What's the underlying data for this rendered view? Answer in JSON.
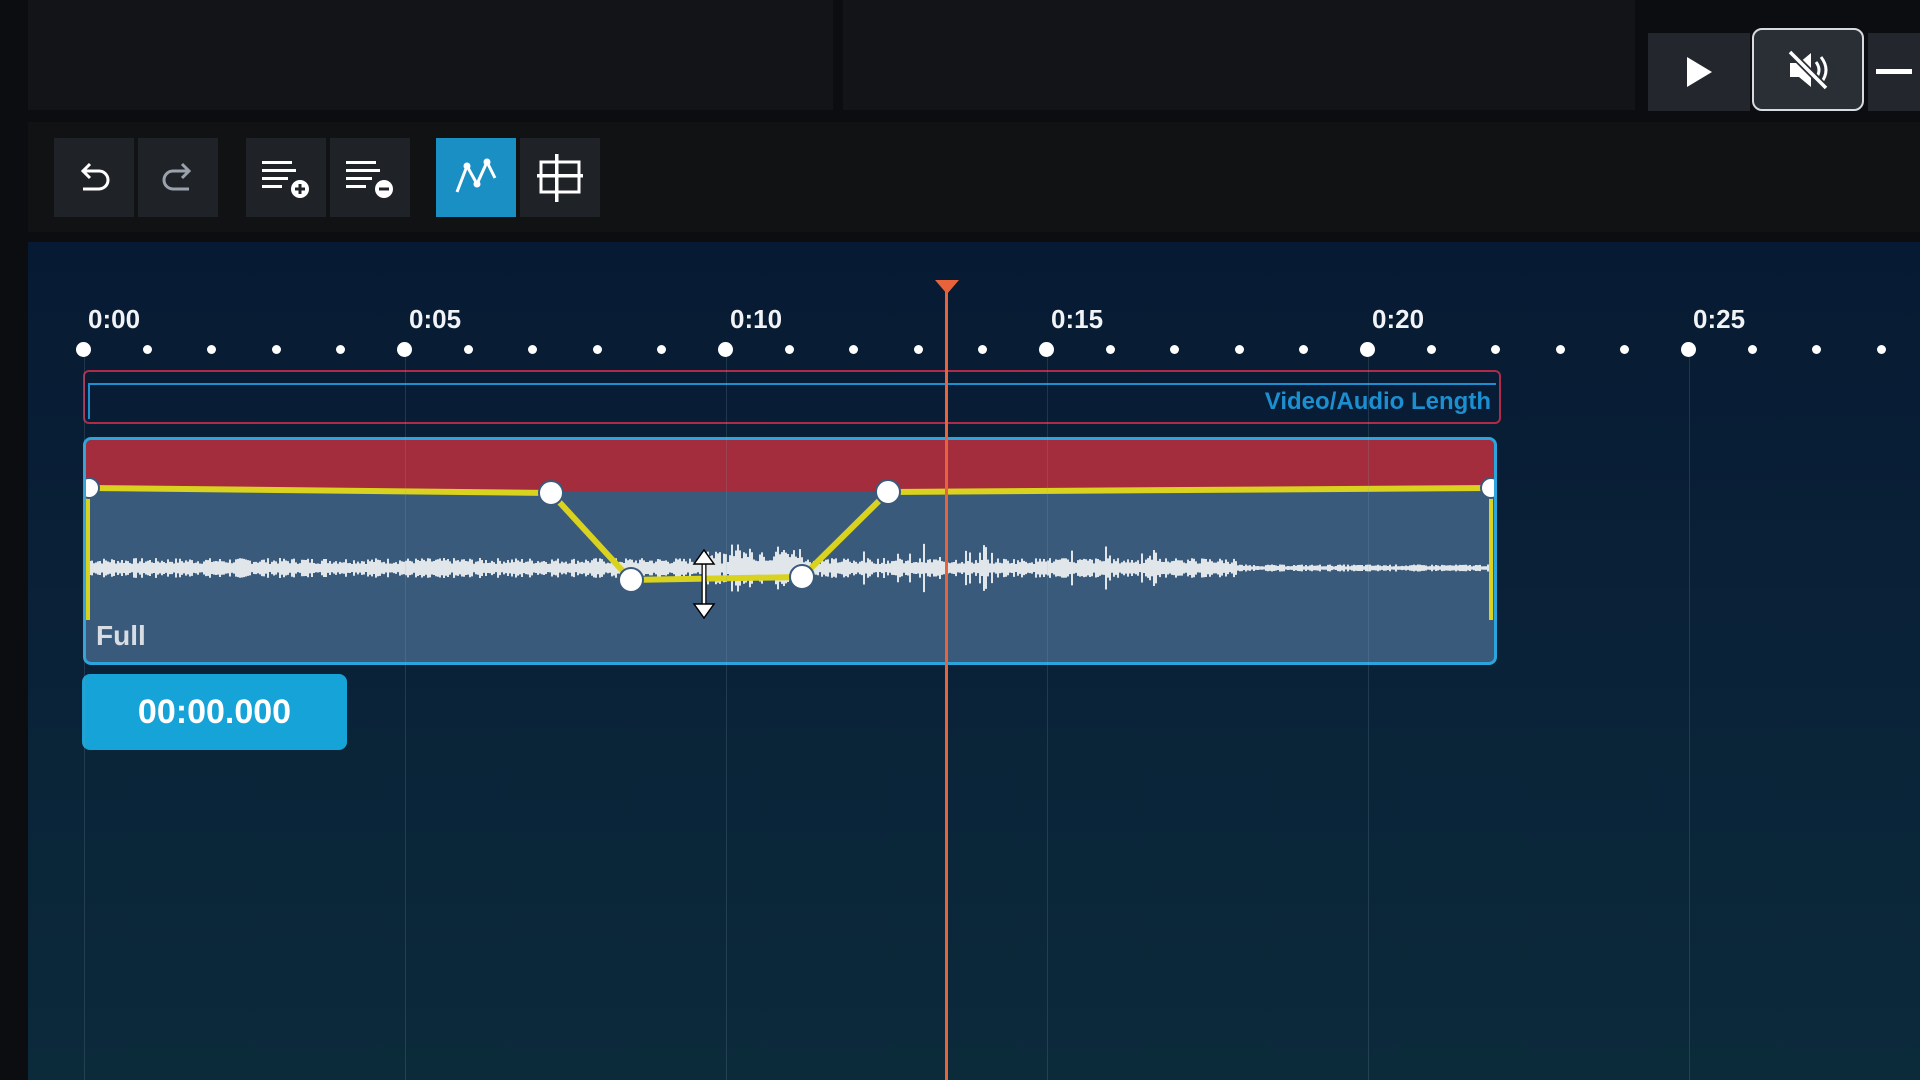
{
  "toolbar": {
    "buttons": [
      "undo",
      "redo",
      "add-track",
      "remove-track",
      "volume-envelope",
      "trim"
    ]
  },
  "timeline": {
    "ticks": [
      "0:00",
      "0:05",
      "0:10",
      "0:15",
      "0:20",
      "0:25"
    ],
    "length_label": "Video/Audio Length",
    "clip_label": "Full",
    "current_time": "00:00.000"
  },
  "colors": {
    "accent": "#1a8fc4",
    "envelope": "#d9d21e",
    "clip_header": "#a32c3d",
    "playhead": "#e8623a"
  },
  "icons": {
    "play": "play-icon",
    "mute": "mute-icon",
    "undo": "undo-icon",
    "redo": "redo-icon"
  }
}
